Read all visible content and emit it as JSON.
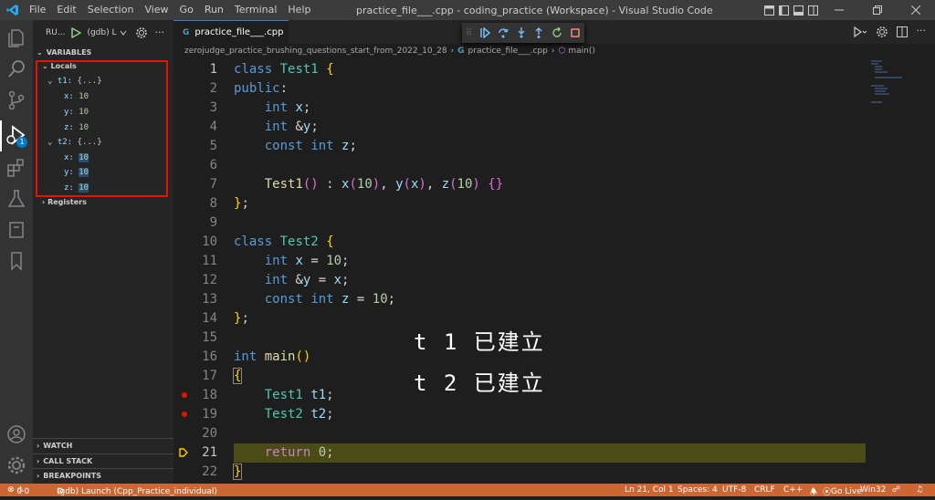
{
  "window": {
    "title": "practice_file___.cpp - coding_practice (Workspace) - Visual Studio Code",
    "menu": [
      "File",
      "Edit",
      "Selection",
      "View",
      "Go",
      "Run",
      "Terminal",
      "Help"
    ]
  },
  "run": {
    "label": "RU...",
    "config": "(gdb) L"
  },
  "sidebar": {
    "variables": "VARIABLES",
    "locals": "Locals",
    "registers": "Registers",
    "watch": "WATCH",
    "call_stack": "CALL STACK",
    "breakpoints": "BREAKPOINTS",
    "vars": [
      {
        "name": "t1:",
        "value": "{...}"
      },
      {
        "name": "x:",
        "value": "10"
      },
      {
        "name": "y:",
        "value": "10"
      },
      {
        "name": "z:",
        "value": "10"
      },
      {
        "name": "t2:",
        "value": "{...}"
      },
      {
        "name": "x:",
        "value": "10"
      },
      {
        "name": "y:",
        "value": "10"
      },
      {
        "name": "z:",
        "value": "10"
      }
    ]
  },
  "badge": "1",
  "tab": {
    "label": "practice_file___.cpp"
  },
  "breadcrumb": {
    "folder": "zerojudge_practice_brushing_questions_start_from_2022_10_28",
    "file": "practice_file___.cpp",
    "symbol": "main()"
  },
  "lines": [
    "1",
    "2",
    "3",
    "4",
    "5",
    "6",
    "7",
    "8",
    "9",
    "10",
    "11",
    "12",
    "13",
    "14",
    "15",
    "16",
    "17",
    "18",
    "19",
    "20",
    "21",
    "22"
  ],
  "annotations": {
    "a1": "t 1 已建立",
    "a2": "t 2 已建立"
  },
  "status": {
    "errors": "0",
    "warnings": "0",
    "launch": "(gdb) Launch (Cpp_Practice_individual)",
    "pos": "Ln 21, Col 1",
    "spaces": "Spaces: 4",
    "enc": "UTF-8",
    "eol": "CRLF",
    "lang": "C++",
    "golive": "Go Live",
    "platform": "Win32"
  },
  "colors": {
    "accent": "#cc6633",
    "breakpoint": "#e51400",
    "highlight": "#4b4b18"
  }
}
